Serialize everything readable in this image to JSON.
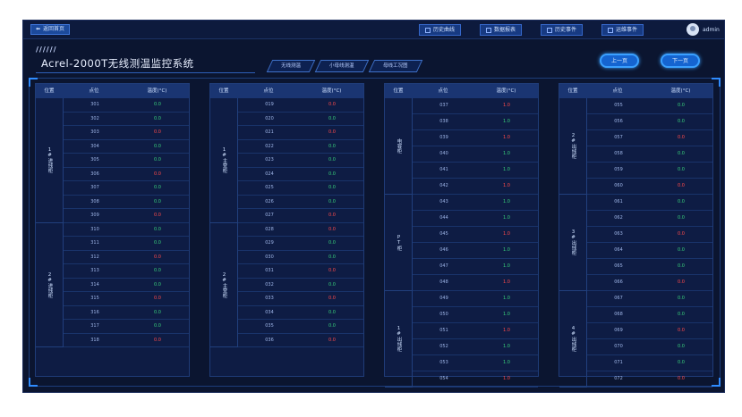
{
  "topbar": {
    "back_label": "返回首页",
    "nav": [
      {
        "label": "历史曲线",
        "icon": "chart-icon"
      },
      {
        "label": "数据报表",
        "icon": "report-icon"
      },
      {
        "label": "历史事件",
        "icon": "event-icon"
      },
      {
        "label": "运维事件",
        "icon": "maintenance-icon"
      }
    ],
    "user": "admin"
  },
  "header": {
    "stripes": "//////",
    "title": "Acrel-2000T无线测温监控系统",
    "tabs": [
      "无线测温",
      "小母线测温",
      "母线工况图"
    ],
    "prev_label": "上一页",
    "next_label": "下一页"
  },
  "columns": {
    "location": "位置",
    "point": "点位",
    "temp": "温度(°C)"
  },
  "colors": {
    "normal": "#37d07a",
    "alarm": "#ff4a4a",
    "accent": "#1564d0"
  },
  "panels": [
    {
      "groups": [
        {
          "location": "1#进线柜",
          "rows": [
            {
              "point": "301",
              "temp": "0.0",
              "status": "normal"
            },
            {
              "point": "302",
              "temp": "0.0",
              "status": "normal"
            },
            {
              "point": "303",
              "temp": "0.0",
              "status": "alarm"
            },
            {
              "point": "304",
              "temp": "0.0",
              "status": "normal"
            },
            {
              "point": "305",
              "temp": "0.0",
              "status": "normal"
            },
            {
              "point": "306",
              "temp": "0.0",
              "status": "alarm"
            },
            {
              "point": "307",
              "temp": "0.0",
              "status": "normal"
            },
            {
              "point": "308",
              "temp": "0.0",
              "status": "normal"
            },
            {
              "point": "309",
              "temp": "0.0",
              "status": "alarm"
            }
          ]
        },
        {
          "location": "2#进线柜",
          "rows": [
            {
              "point": "310",
              "temp": "0.0",
              "status": "normal"
            },
            {
              "point": "311",
              "temp": "0.0",
              "status": "normal"
            },
            {
              "point": "312",
              "temp": "0.0",
              "status": "alarm"
            },
            {
              "point": "313",
              "temp": "0.0",
              "status": "normal"
            },
            {
              "point": "314",
              "temp": "0.0",
              "status": "normal"
            },
            {
              "point": "315",
              "temp": "0.0",
              "status": "alarm"
            },
            {
              "point": "316",
              "temp": "0.0",
              "status": "normal"
            },
            {
              "point": "317",
              "temp": "0.0",
              "status": "normal"
            },
            {
              "point": "318",
              "temp": "0.0",
              "status": "alarm"
            }
          ]
        }
      ]
    },
    {
      "groups": [
        {
          "location": "1#主变柜",
          "rows": [
            {
              "point": "019",
              "temp": "0.0",
              "status": "alarm"
            },
            {
              "point": "020",
              "temp": "0.0",
              "status": "normal"
            },
            {
              "point": "021",
              "temp": "0.0",
              "status": "alarm"
            },
            {
              "point": "022",
              "temp": "0.0",
              "status": "normal"
            },
            {
              "point": "023",
              "temp": "0.0",
              "status": "normal"
            },
            {
              "point": "024",
              "temp": "0.0",
              "status": "normal"
            },
            {
              "point": "025",
              "temp": "0.0",
              "status": "normal"
            },
            {
              "point": "026",
              "temp": "0.0",
              "status": "normal"
            },
            {
              "point": "027",
              "temp": "0.0",
              "status": "alarm"
            }
          ]
        },
        {
          "location": "2#主变柜",
          "rows": [
            {
              "point": "028",
              "temp": "0.0",
              "status": "alarm"
            },
            {
              "point": "029",
              "temp": "0.0",
              "status": "normal"
            },
            {
              "point": "030",
              "temp": "0.0",
              "status": "normal"
            },
            {
              "point": "031",
              "temp": "0.0",
              "status": "alarm"
            },
            {
              "point": "032",
              "temp": "0.0",
              "status": "normal"
            },
            {
              "point": "033",
              "temp": "0.0",
              "status": "alarm"
            },
            {
              "point": "034",
              "temp": "0.0",
              "status": "normal"
            },
            {
              "point": "035",
              "temp": "0.0",
              "status": "normal"
            },
            {
              "point": "036",
              "temp": "0.0",
              "status": "alarm"
            }
          ]
        }
      ]
    },
    {
      "groups": [
        {
          "location": "电容柜",
          "rows": [
            {
              "point": "037",
              "temp": "1.0",
              "status": "alarm"
            },
            {
              "point": "038",
              "temp": "1.0",
              "status": "normal"
            },
            {
              "point": "039",
              "temp": "1.0",
              "status": "alarm"
            },
            {
              "point": "040",
              "temp": "1.0",
              "status": "normal"
            },
            {
              "point": "041",
              "temp": "1.0",
              "status": "normal"
            },
            {
              "point": "042",
              "temp": "1.0",
              "status": "alarm"
            }
          ]
        },
        {
          "location": "PT柜",
          "rows": [
            {
              "point": "043",
              "temp": "1.0",
              "status": "normal"
            },
            {
              "point": "044",
              "temp": "1.0",
              "status": "normal"
            },
            {
              "point": "045",
              "temp": "1.0",
              "status": "alarm"
            },
            {
              "point": "046",
              "temp": "1.0",
              "status": "normal"
            },
            {
              "point": "047",
              "temp": "1.0",
              "status": "normal"
            },
            {
              "point": "048",
              "temp": "1.0",
              "status": "alarm"
            }
          ]
        },
        {
          "location": "1#出线柜",
          "rows": [
            {
              "point": "049",
              "temp": "1.0",
              "status": "normal"
            },
            {
              "point": "050",
              "temp": "1.0",
              "status": "normal"
            },
            {
              "point": "051",
              "temp": "1.0",
              "status": "alarm"
            },
            {
              "point": "052",
              "temp": "1.0",
              "status": "normal"
            },
            {
              "point": "053",
              "temp": "1.0",
              "status": "normal"
            },
            {
              "point": "054",
              "temp": "1.0",
              "status": "alarm"
            }
          ]
        }
      ]
    },
    {
      "groups": [
        {
          "location": "2#出线柜",
          "rows": [
            {
              "point": "055",
              "temp": "0.0",
              "status": "normal"
            },
            {
              "point": "056",
              "temp": "0.0",
              "status": "normal"
            },
            {
              "point": "057",
              "temp": "0.0",
              "status": "alarm"
            },
            {
              "point": "058",
              "temp": "0.0",
              "status": "normal"
            },
            {
              "point": "059",
              "temp": "0.0",
              "status": "normal"
            },
            {
              "point": "060",
              "temp": "0.0",
              "status": "alarm"
            }
          ]
        },
        {
          "location": "3#出线柜",
          "rows": [
            {
              "point": "061",
              "temp": "0.0",
              "status": "normal"
            },
            {
              "point": "062",
              "temp": "0.0",
              "status": "normal"
            },
            {
              "point": "063",
              "temp": "0.0",
              "status": "alarm"
            },
            {
              "point": "064",
              "temp": "0.0",
              "status": "normal"
            },
            {
              "point": "065",
              "temp": "0.0",
              "status": "normal"
            },
            {
              "point": "066",
              "temp": "0.0",
              "status": "alarm"
            }
          ]
        },
        {
          "location": "4#出线柜",
          "rows": [
            {
              "point": "067",
              "temp": "0.0",
              "status": "normal"
            },
            {
              "point": "068",
              "temp": "0.0",
              "status": "normal"
            },
            {
              "point": "069",
              "temp": "0.0",
              "status": "alarm"
            },
            {
              "point": "070",
              "temp": "0.0",
              "status": "normal"
            },
            {
              "point": "071",
              "temp": "0.0",
              "status": "normal"
            },
            {
              "point": "072",
              "temp": "0.0",
              "status": "alarm"
            }
          ]
        }
      ]
    }
  ]
}
